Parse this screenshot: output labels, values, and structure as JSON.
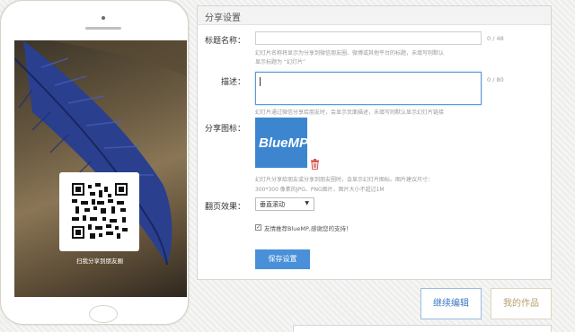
{
  "phone": {
    "qr_caption": "扫我分享到朋友圈"
  },
  "panel": {
    "header": "分享设置",
    "title_field": {
      "label": "标题名称：",
      "value": "",
      "counter": "0 / 48",
      "hint_line1": "幻灯片名称将显示为分享到微信朋友圈、微博或其他平台的标题，未填写则默认",
      "hint_line2": "显示标题为 “幻灯片”"
    },
    "description_field": {
      "label": "描述：",
      "value": "",
      "counter": "0 / 80",
      "hint": "幻灯片通过微信分享给朋友时，会显示页面描述，未填写则默认显示幻灯片链接"
    },
    "share_icon": {
      "label": "分享图标：",
      "logo_text": "BlueMP",
      "icon": "trash-icon",
      "hint_line1": "幻灯片分享给朋友或分享到朋友圈时，会显示幻灯片图标。图片建议尺寸：",
      "hint_line2": "300*300 像素的JPG、PNG图片，图片大小不超过1M"
    },
    "page_effect": {
      "label": "翻页效果：",
      "selected": "垂直滚动"
    },
    "recommend": {
      "checked": true,
      "label": "友情推荐BlueMP,感谢您的支持！"
    },
    "save_label": "保存设置"
  },
  "actions": {
    "continue_label": "继续编辑",
    "my_works_label": "我的作品"
  },
  "colors": {
    "accent": "#4a90d9",
    "logo_bg": "#3d86cf",
    "delete_icon": "#d9534f",
    "works_text": "#b59f6e"
  }
}
